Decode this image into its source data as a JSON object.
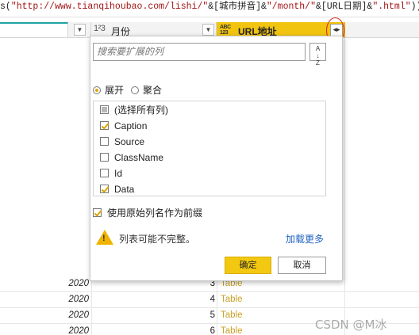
{
  "formula_bar": {
    "prefix": "s(",
    "s1": "\"http://www.tianqihoubao.com/lishi/\"",
    "amp1": "&[城市拼音]&",
    "s2": "\"/month/\"",
    "amp2": "&[URL日期]&",
    "s3": "\".html\"",
    "suffix": ")))"
  },
  "columns": {
    "month": {
      "type_icon": "1²3",
      "name": "月份"
    },
    "url": {
      "type_icon_top": "ABC",
      "type_icon_bottom": "123",
      "name": "URL地址"
    }
  },
  "rows": [
    {
      "year": "2020",
      "month": "3",
      "url": "Table"
    },
    {
      "year": "2020",
      "month": "4",
      "url": "Table"
    },
    {
      "year": "2020",
      "month": "5",
      "url": "Table"
    },
    {
      "year": "2020",
      "month": "6",
      "url": "Table"
    }
  ],
  "popup": {
    "search_placeholder": "搜索要扩展的列",
    "sort_icon": "A↓Z",
    "radio_expand": "展开",
    "radio_aggregate": "聚合",
    "selected_mode": "expand",
    "items": [
      {
        "label": "(选择所有列)",
        "state": "partial"
      },
      {
        "label": "Caption",
        "state": "checked"
      },
      {
        "label": "Source",
        "state": "unchecked"
      },
      {
        "label": "ClassName",
        "state": "unchecked"
      },
      {
        "label": "Id",
        "state": "unchecked"
      },
      {
        "label": "Data",
        "state": "checked"
      }
    ],
    "prefix_option": "使用原始列名作为前缀",
    "prefix_checked": true,
    "warning_text": "列表可能不完整。",
    "load_more": "加载更多",
    "ok_label": "确定",
    "cancel_label": "取消"
  },
  "watermark": "CSDN @M冰",
  "colors": {
    "header_selected": "#f1c40f",
    "accent": "#f2c811",
    "table_link": "#c9a227",
    "annotation": "#e0201b"
  }
}
